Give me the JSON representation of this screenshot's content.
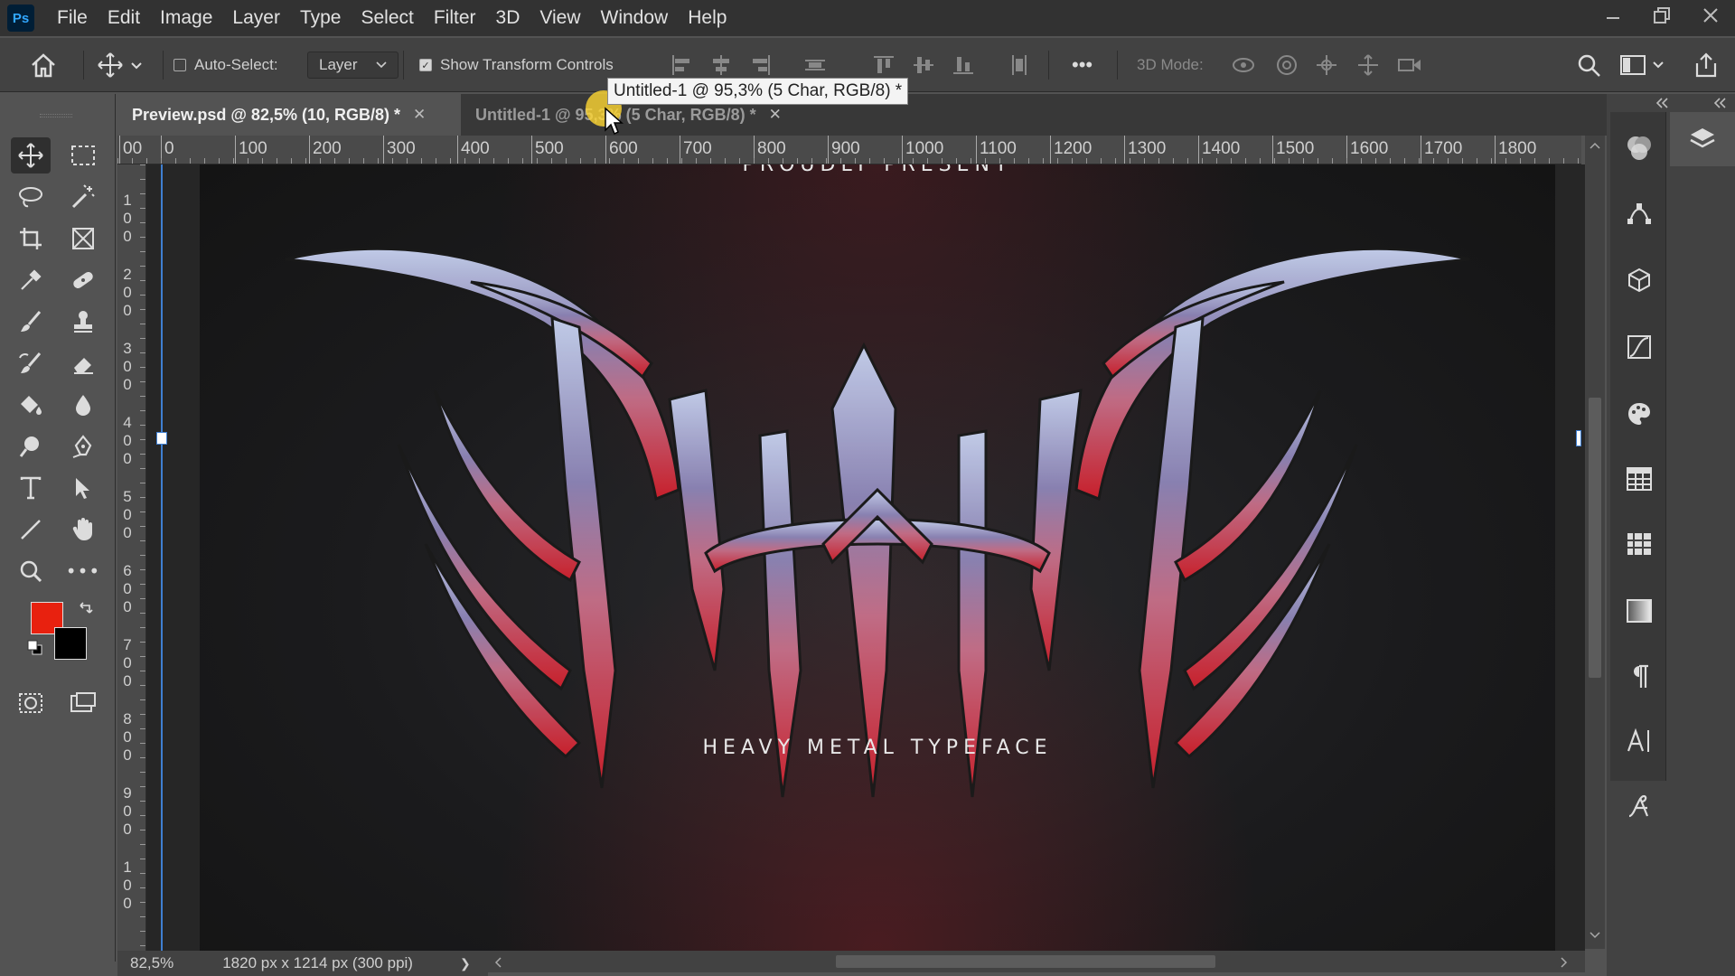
{
  "app": {
    "logo": "Ps",
    "accent": "#31a8ff"
  },
  "menu": [
    "File",
    "Edit",
    "Image",
    "Layer",
    "Type",
    "Select",
    "Filter",
    "3D",
    "View",
    "Window",
    "Help"
  ],
  "options_bar": {
    "auto_select_label": "Auto-Select:",
    "auto_select_checked": false,
    "auto_select_target": "Layer",
    "show_transform_label": "Show Transform Controls",
    "show_transform_checked": true,
    "more_label": "•••",
    "mode_label": "3D Mode:"
  },
  "tabs": [
    {
      "label": "Preview.psd @ 82,5% (10, RGB/8) *",
      "active": true
    },
    {
      "label": "Untitled-1 @ 95,3% (5 Char, RGB/8) *",
      "active": false
    }
  ],
  "tooltip": "Untitled-1 @ 95,3% (5 Char, RGB/8) *",
  "ruler_top": [
    "00",
    "0",
    "100",
    "200",
    "300",
    "400",
    "500",
    "600",
    "700",
    "800",
    "900",
    "1000",
    "1100",
    "1200",
    "1300",
    "1400",
    "1500",
    "1600",
    "1700",
    "1800"
  ],
  "ruler_left": [
    "100",
    "200",
    "300",
    "400",
    "500",
    "600",
    "700",
    "800",
    "900",
    "100"
  ],
  "artwork": {
    "top_text": "PROUDLY PRESENT",
    "bottom_text": "HEAVY METAL TYPEFACE"
  },
  "colors": {
    "foreground": "#e8210f",
    "background": "#000000"
  },
  "status": {
    "zoom": "82,5%",
    "doc_info": "1820 px x 1214 px (300 ppi)",
    "arrow": "❯"
  }
}
